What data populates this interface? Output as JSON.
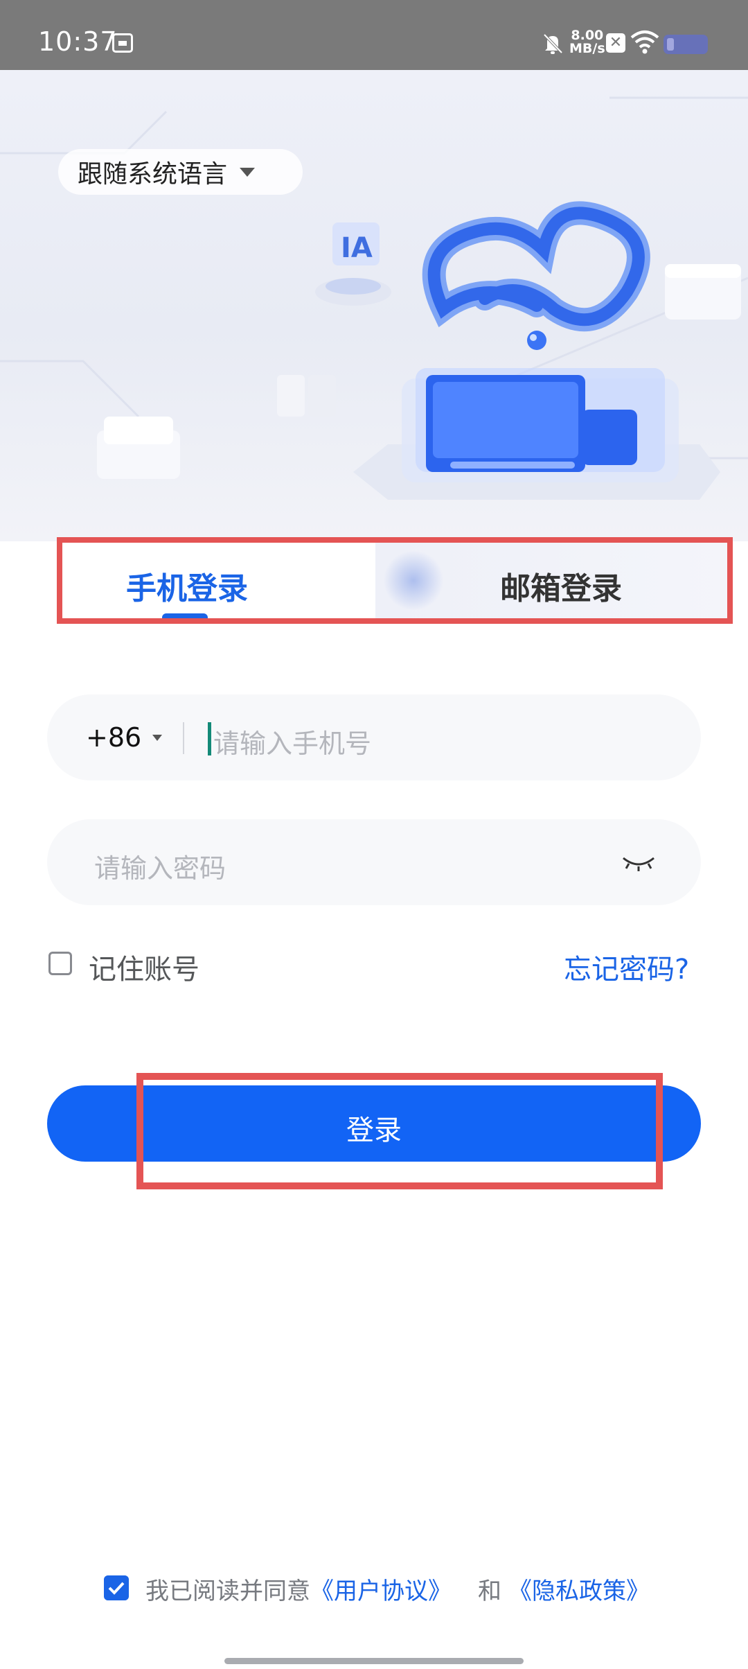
{
  "status_bar": {
    "time": "10:37",
    "net_speed_value": "8.00",
    "net_speed_unit": "MB/s",
    "icons": [
      "notification-app-icon",
      "mute-bell-icon",
      "close-badge-icon",
      "wifi-icon",
      "battery-icon"
    ]
  },
  "language_selector": {
    "label": "跟随系统语言",
    "icon": "caret-down-icon"
  },
  "tabs": [
    {
      "label": "手机登录",
      "active": true
    },
    {
      "label": "邮箱登录",
      "active": false
    }
  ],
  "phone_field": {
    "country_code": "+86",
    "placeholder": "请输入手机号"
  },
  "password_field": {
    "placeholder": "请输入密码",
    "visibility_icon": "eye-closed-icon"
  },
  "remember_account": {
    "label": "记住账号",
    "checked": false
  },
  "forgot_password": {
    "label": "忘记密码?"
  },
  "login_button": {
    "label": "登录"
  },
  "agreement": {
    "checked": true,
    "prefix": "我已阅读并同意",
    "user_agreement": "《用户协议》",
    "and": "和",
    "privacy_policy": "《隐私政策》"
  },
  "colors": {
    "accent": "#1a64e6",
    "button": "#1264f5",
    "highlight": "#e45454",
    "status_bar": "#7a7a7a"
  }
}
